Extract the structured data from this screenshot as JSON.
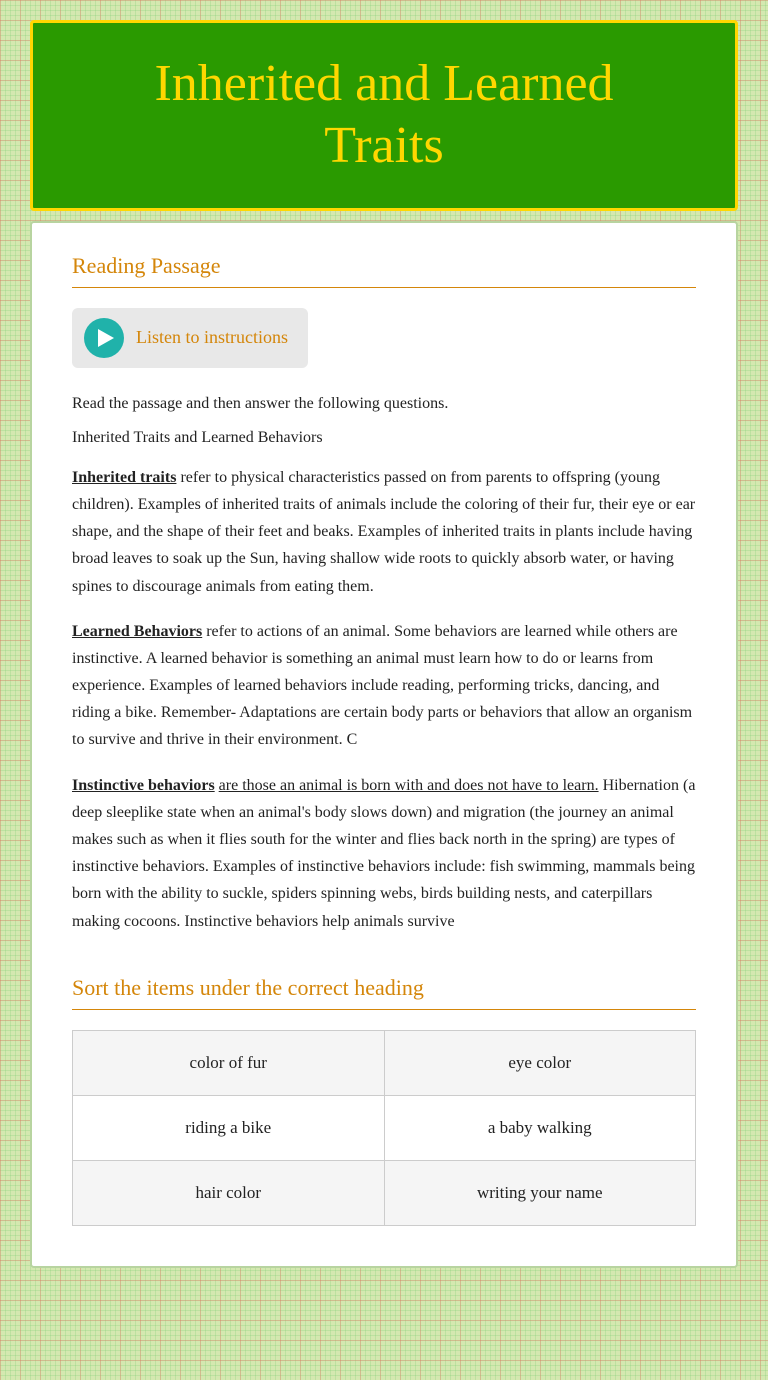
{
  "page": {
    "title_line1": "Inherited and Learned",
    "title_line2": "Traits"
  },
  "reading_section": {
    "heading": "Reading Passage",
    "listen_button_label": "Listen to instructions",
    "intro": "Read the passage and then answer the following questions.",
    "subtitle": "Inherited Traits and Learned Behaviors",
    "para1": " refer to physical characteristics passed on from parents to offspring (young children). Examples of inherited traits of animals include the coloring of their fur, their eye or ear shape, and the shape of their feet and beaks. Examples of inherited traits in plants include having broad leaves to soak up the Sun, having shallow wide roots to quickly absorb water, or having spines to discourage animals from eating them.",
    "para1_bold": "Inherited traits",
    "para2_bold": "Learned Behaviors",
    "para2": "  refer to actions of an animal. Some behaviors are learned while others are instinctive. A learned behavior is something an animal must learn how to do or learns from experience. Examples of learned behaviors include reading, performing tricks, dancing, and riding a bike. Remember- Adaptations are certain body parts or behaviors that allow an organism to survive and thrive in their environment. C",
    "para3_bold": "Instinctive behaviors",
    "para3_underline": "are those an animal is born with and does not have to learn.",
    "para3": " Hibernation (a deep sleeplike state when an animal's body slows down) and migration (the journey an animal makes such as when it flies south for the winter and flies back north in the spring) are types of instinctive behaviors. Examples of instinctive behaviors include: fish swimming, mammals being born with the ability to suckle, spiders spinning webs, birds building nests, and caterpillars making cocoons. Instinctive behaviors help animals survive"
  },
  "sort_section": {
    "heading": "Sort the items under the correct heading",
    "rows": [
      {
        "left": "color of fur",
        "right": "eye color"
      },
      {
        "left": "riding a bike",
        "right": "a baby walking"
      },
      {
        "left": "hair color",
        "right": "writing your name"
      }
    ]
  }
}
